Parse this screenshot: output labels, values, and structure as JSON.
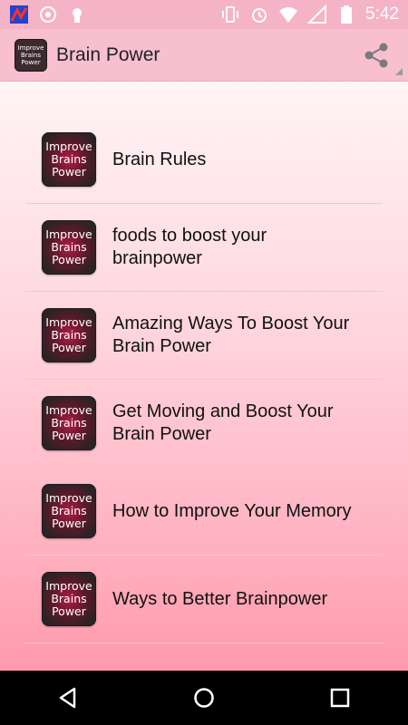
{
  "status_bar": {
    "time": "5:42",
    "left_icons": [
      "app-notification-icon",
      "assistant-icon",
      "android-debug-icon"
    ],
    "right_icons": [
      "vibrate-icon",
      "alarm-icon",
      "wifi-icon",
      "signal-icon",
      "battery-icon"
    ]
  },
  "app_bar": {
    "title": "Brain Power",
    "logo_text": [
      "Improve",
      "Brains",
      "Power"
    ],
    "share_icon": "share-icon"
  },
  "list": {
    "icon_text": [
      "Improve",
      "Brains",
      "Power"
    ],
    "items": [
      {
        "label": "Brain Rules"
      },
      {
        "label": "foods to boost your brainpower"
      },
      {
        "label": "Amazing Ways To Boost Your Brain Power"
      },
      {
        "label": "Get Moving and Boost Your Brain Power"
      },
      {
        "label": "How to Improve Your Memory"
      },
      {
        "label": "Ways to Better Brainpower"
      }
    ]
  },
  "nav_bar": {
    "buttons": [
      "back-icon",
      "home-icon",
      "recents-icon"
    ]
  },
  "colors": {
    "status_bar": "#f5b3c7",
    "app_bar": "#f7bfd0",
    "icon_accent": "#b51b46"
  }
}
